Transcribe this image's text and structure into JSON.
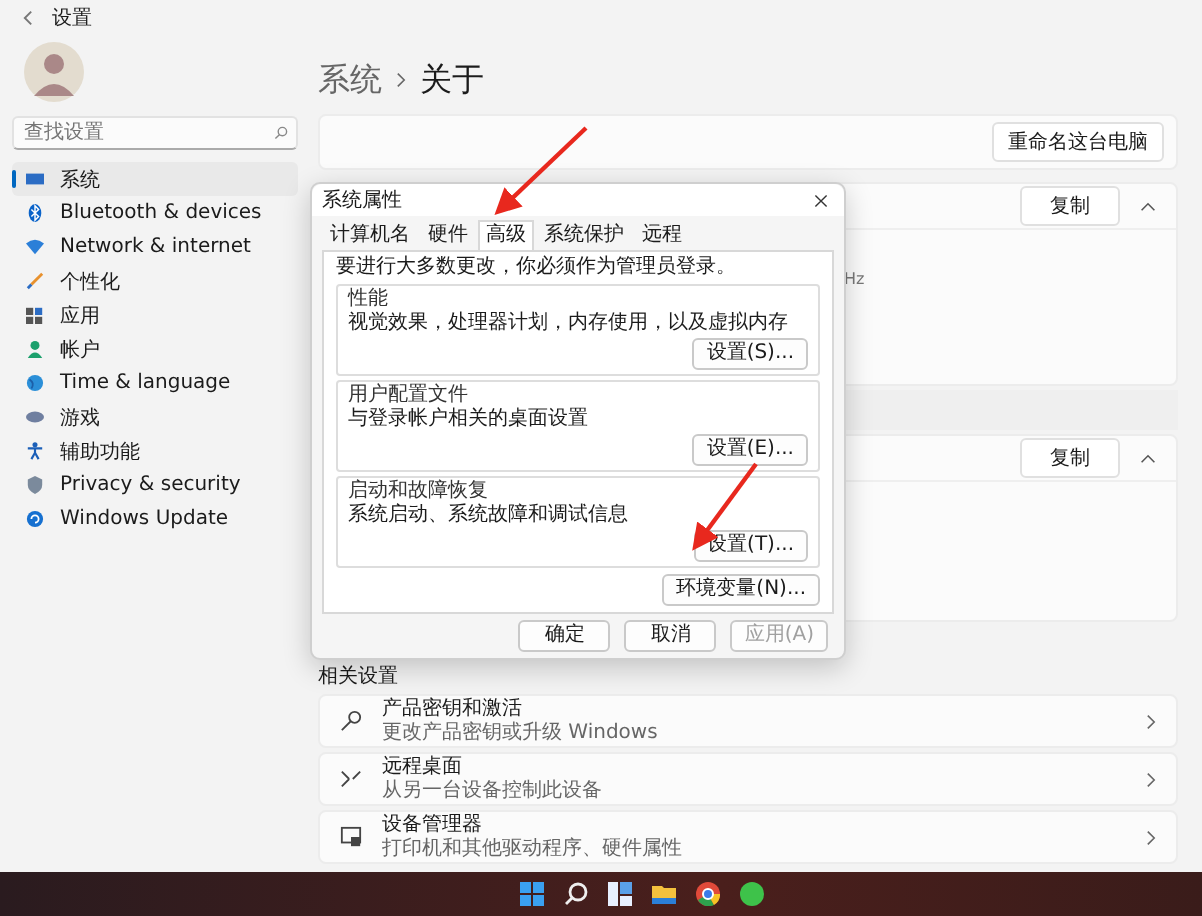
{
  "window": {
    "title": "设置"
  },
  "sidebar": {
    "search": {
      "placeholder": "查找设置"
    },
    "items": [
      {
        "label": "系统",
        "selected": true
      },
      {
        "label": "Bluetooth & devices",
        "selected": false
      },
      {
        "label": "Network & internet",
        "selected": false
      },
      {
        "label": "个性化",
        "selected": false
      },
      {
        "label": "应用",
        "selected": false
      },
      {
        "label": "帐户",
        "selected": false
      },
      {
        "label": "Time & language",
        "selected": false
      },
      {
        "label": "游戏",
        "selected": false
      },
      {
        "label": "辅助功能",
        "selected": false
      },
      {
        "label": "Privacy & security",
        "selected": false
      },
      {
        "label": "Windows Update",
        "selected": false
      }
    ]
  },
  "breadcrumb": [
    "系统",
    "关于"
  ],
  "rename_button": "重命名这台电脑",
  "device_spec": {
    "copy_button": "复制",
    "expanded": true,
    "partial_text": "Hz"
  },
  "windows_spec": {
    "copy_button": "复制",
    "expanded": true
  },
  "related": {
    "title": "相关设置",
    "items": [
      {
        "title": "产品密钥和激活",
        "subtitle": "更改产品密钥或升级 Windows"
      },
      {
        "title": "远程桌面",
        "subtitle": "从另一台设备控制此设备"
      },
      {
        "title": "设备管理器",
        "subtitle": "打印机和其他驱动程序、硬件属性"
      }
    ]
  },
  "dialog": {
    "title": "系统属性",
    "tabs": [
      {
        "label": "计算机名",
        "selected": false
      },
      {
        "label": "硬件",
        "selected": false
      },
      {
        "label": "高级",
        "selected": true
      },
      {
        "label": "系统保护",
        "selected": false
      },
      {
        "label": "远程",
        "selected": false
      }
    ],
    "note": "要进行大多数更改，你必须作为管理员登录。",
    "groups": [
      {
        "title": "性能",
        "description": "视觉效果，处理器计划，内存使用，以及虚拟内存",
        "button": "设置(S)..."
      },
      {
        "title": "用户配置文件",
        "description": "与登录帐户相关的桌面设置",
        "button": "设置(E)..."
      },
      {
        "title": "启动和故障恢复",
        "description": "系统启动、系统故障和调试信息",
        "button": "设置(T)..."
      }
    ],
    "env_button": "环境变量(N)...",
    "buttons": [
      {
        "label": "确定",
        "disabled": false
      },
      {
        "label": "取消",
        "disabled": false
      },
      {
        "label": "应用(A)",
        "disabled": true
      }
    ]
  }
}
